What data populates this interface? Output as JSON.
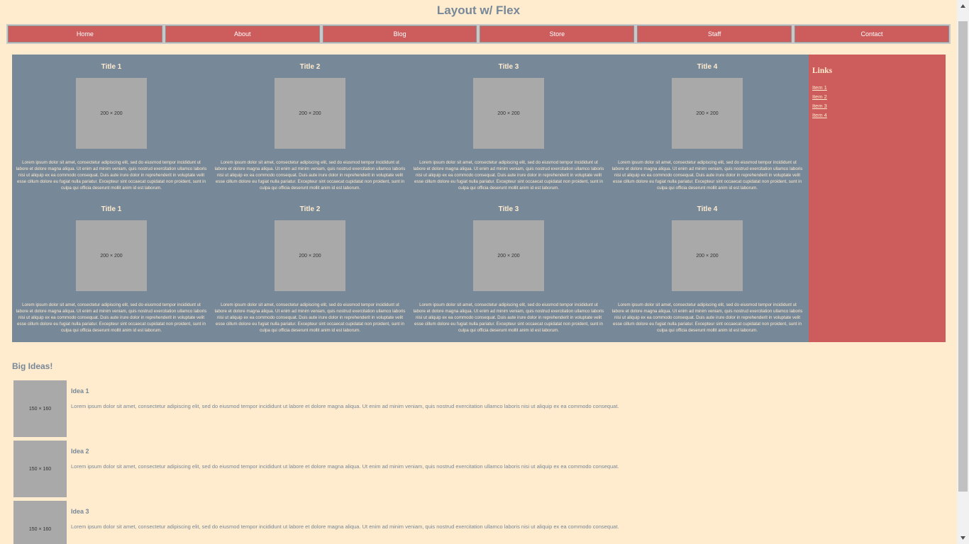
{
  "header": {
    "title": "Layout w/ Flex"
  },
  "nav": {
    "items": [
      {
        "label": "Home"
      },
      {
        "label": "About"
      },
      {
        "label": "Blog"
      },
      {
        "label": "Store"
      },
      {
        "label": "Staff"
      },
      {
        "label": "Contact"
      }
    ]
  },
  "cards": {
    "placeholder": "200 × 200",
    "text": "Lorem ipsum dolor sit amet, consectetur adipiscing elit, sed do eiusmod tempor incididunt ut labore et dolore magna aliqua. Ut enim ad minim veniam, quis nostrud exercitation ullamco laboris nisi ut aliquip ex ea commodo consequat. Duis aute irure dolor in reprehenderit in voluptate velit esse cillum dolore eu fugiat nulla pariatur. Excepteur sint occaecat cupidatat non proident, sunt in culpa qui officia deserunt mollit anim id est laborum.",
    "items": [
      {
        "title": "Title 1"
      },
      {
        "title": "Title 2"
      },
      {
        "title": "Title 3"
      },
      {
        "title": "Title 4"
      },
      {
        "title": "Title 1"
      },
      {
        "title": "Title 2"
      },
      {
        "title": "Title 3"
      },
      {
        "title": "Title 4"
      }
    ]
  },
  "sidebar": {
    "title": "Links",
    "links": [
      {
        "label": "Item 1"
      },
      {
        "label": "Item 2"
      },
      {
        "label": "Item 3"
      },
      {
        "label": "Item 4"
      }
    ]
  },
  "ideas": {
    "title": "Big Ideas!",
    "placeholder": "150 × 160",
    "text": "Lorem ipsum dolor sit amet, consectetur adipiscing elit, sed do eiusmod tempor incididunt ut labore et dolore magna aliqua. Ut enim ad minim veniam, quis nostrud exercitation ullamco laboris nisi ut aliquip ex ea commodo consequat.",
    "items": [
      {
        "title": "Idea 1"
      },
      {
        "title": "Idea 2"
      },
      {
        "title": "Idea 3"
      }
    ]
  },
  "colors": {
    "background": "#ffebcd",
    "slate": "#778899",
    "accent": "#cd5c5c",
    "placeholder": "#a9a9a9"
  },
  "icons": {
    "scroll_up": "chevron-up-icon",
    "scroll_down": "chevron-down-icon"
  }
}
